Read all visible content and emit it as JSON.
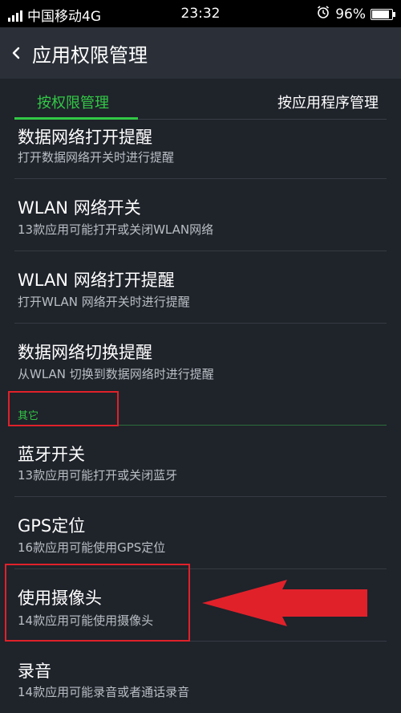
{
  "status_bar": {
    "carrier": "中国移动4G",
    "time": "23:32",
    "battery": "96%",
    "battery_level": 0.96
  },
  "header": {
    "back_icon": "chevron-left-icon",
    "title": "应用权限管理"
  },
  "tabs": [
    {
      "label": "按权限管理",
      "active": true
    },
    {
      "label": "按应用程序管理",
      "active": false
    }
  ],
  "list": {
    "items": [
      {
        "title": "数据网络打开提醒",
        "subtitle": "打开数据网络开关时进行提醒"
      },
      {
        "title": "WLAN 网络开关",
        "subtitle": "13款应用可能打开或关闭WLAN网络"
      },
      {
        "title": "WLAN 网络打开提醒",
        "subtitle": "打开WLAN 网络开关时进行提醒"
      },
      {
        "title": "数据网络切换提醒",
        "subtitle": "从WLAN 切换到数据网络时进行提醒"
      }
    ],
    "section_label": "其它",
    "other_items": [
      {
        "title": "蓝牙开关",
        "subtitle": "13款应用可能打开或关闭蓝牙"
      },
      {
        "title": "GPS定位",
        "subtitle": "16款应用可能使用GPS定位"
      },
      {
        "title": "使用摄像头",
        "subtitle": "14款应用可能使用摄像头"
      },
      {
        "title": "录音",
        "subtitle": "14款应用可能录音或者通话录音"
      }
    ]
  },
  "annotation_color": "#e0212a",
  "accent_color": "#32c846"
}
